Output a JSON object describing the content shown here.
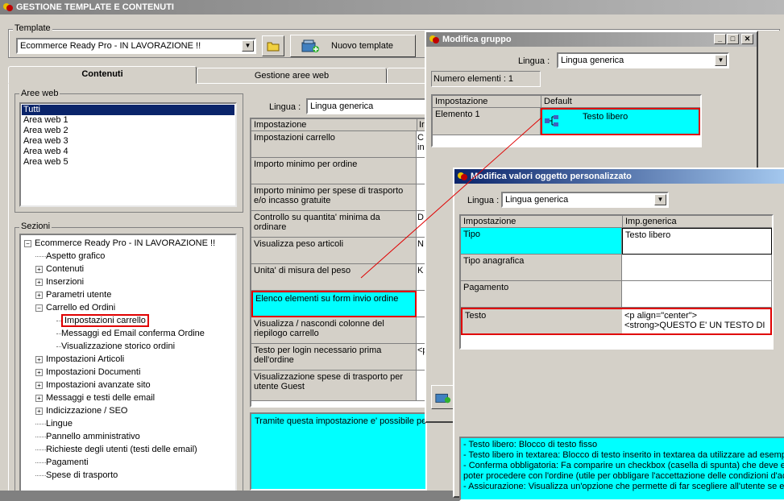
{
  "main_window": {
    "title": "GESTIONE TEMPLATE E CONTENUTI",
    "template_label": "Template",
    "template_value": "Ecommerce Ready Pro - IN LAVORAZIONE !!",
    "new_template_label": "Nuovo template",
    "tabs": [
      "Contenuti",
      "Gestione aree web"
    ],
    "aree_web_label": "Aree web",
    "aree_web_items": [
      "Tutti",
      "Area web 1",
      "Area web 2",
      "Area web 3",
      "Area web 4",
      "Area web 5"
    ],
    "sezioni_label": "Sezioni",
    "tree": [
      {
        "label": "Ecommerce Ready Pro - IN LAVORAZIONE !!",
        "level": 0,
        "toggle": "−"
      },
      {
        "label": "Aspetto grafico",
        "level": 1,
        "toggle": ""
      },
      {
        "label": "Contenuti",
        "level": 1,
        "toggle": "+"
      },
      {
        "label": "Inserzioni",
        "level": 1,
        "toggle": "+"
      },
      {
        "label": "Parametri utente",
        "level": 1,
        "toggle": "+"
      },
      {
        "label": "Carrello ed Ordini",
        "level": 1,
        "toggle": "−"
      },
      {
        "label": "Impostazioni carrello",
        "level": 2,
        "toggle": "",
        "selected": true
      },
      {
        "label": "Messaggi ed Email conferma Ordine",
        "level": 2,
        "toggle": ""
      },
      {
        "label": "Visualizzazione storico ordini",
        "level": 2,
        "toggle": ""
      },
      {
        "label": "Impostazioni Articoli",
        "level": 1,
        "toggle": "+"
      },
      {
        "label": "Impostazioni Documenti",
        "level": 1,
        "toggle": "+"
      },
      {
        "label": "Impostazioni avanzate sito",
        "level": 1,
        "toggle": "+"
      },
      {
        "label": "Messaggi e testi delle email",
        "level": 1,
        "toggle": "+"
      },
      {
        "label": "Indicizzazione / SEO",
        "level": 1,
        "toggle": "+"
      },
      {
        "label": "Lingue",
        "level": 1,
        "toggle": ""
      },
      {
        "label": "Pannello amministrativo",
        "level": 1,
        "toggle": ""
      },
      {
        "label": "Richieste degli utenti (testi delle email)",
        "level": 1,
        "toggle": ""
      },
      {
        "label": "Pagamenti",
        "level": 1,
        "toggle": ""
      },
      {
        "label": "Spese di trasporto",
        "level": 1,
        "toggle": ""
      }
    ],
    "lingua_label": "Lingua :",
    "lingua_value": "Lingua generica",
    "grid_header_col1": "Impostazione",
    "grid_header_col2": "Ir",
    "grid_rows": [
      {
        "label": "Impostazioni carrello",
        "value": "C\nin"
      },
      {
        "label": "Importo minimo per ordine",
        "value": ""
      },
      {
        "label": "Importo minimo per spese di trasporto e/o incasso gratuite",
        "value": ""
      },
      {
        "label": "Controllo su quantita' minima da ordinare",
        "value": "D"
      },
      {
        "label": "Visualizza peso articoli",
        "value": "N"
      },
      {
        "label": "Unita' di misura del peso",
        "value": "K"
      },
      {
        "label": "Elenco elementi su form invio ordine",
        "value": "",
        "highlight": true
      },
      {
        "label": "Visualizza / nascondi colonne del riepilogo carrello",
        "value": ""
      },
      {
        "label": "Testo per login necessario prima dell'ordine",
        "value": "<p"
      },
      {
        "label": "Visualizzazione spese di trasporto per utente Guest",
        "value": ""
      }
    ],
    "description": "Tramite questa impostazione e' possibile per"
  },
  "group_window": {
    "title": "Modifica gruppo",
    "lingua_label": "Lingua :",
    "lingua_value": "Lingua generica",
    "count_label": "Numero elementi : 1",
    "col1": "Impostazione",
    "col2": "Default",
    "row_label": "Elemento 1",
    "row_value": "Testo libero"
  },
  "custom_window": {
    "title": "Modifica valori oggetto personalizzato",
    "lingua_label": "Lingua :",
    "lingua_value": "Lingua generica",
    "col1": "Impostazione",
    "col2": "Imp.generica",
    "rows": [
      {
        "label": "Tipo",
        "value": "Testo libero"
      },
      {
        "label": "Tipo anagrafica",
        "value": ""
      },
      {
        "label": "Pagamento",
        "value": ""
      },
      {
        "label": "Testo",
        "value": "<p align=\"center\"><strong>QUESTO E' UN TESTO DI"
      }
    ],
    "help_lines": [
      "- Testo libero: Blocco di testo fisso",
      "- Testo libero in textarea: Blocco di testo inserito in textarea da utilizzare ad esempio",
      "- Conferma obbligatoria: Fa comparire un checkbox (casella di spunta) che deve es",
      "poter procedere con l'ordine (utile per obbligare l'accettazione delle condizioni d'acq",
      "- Assicurazione: Visualizza un'opzione che permette di far scegliere all'utente se e"
    ]
  }
}
